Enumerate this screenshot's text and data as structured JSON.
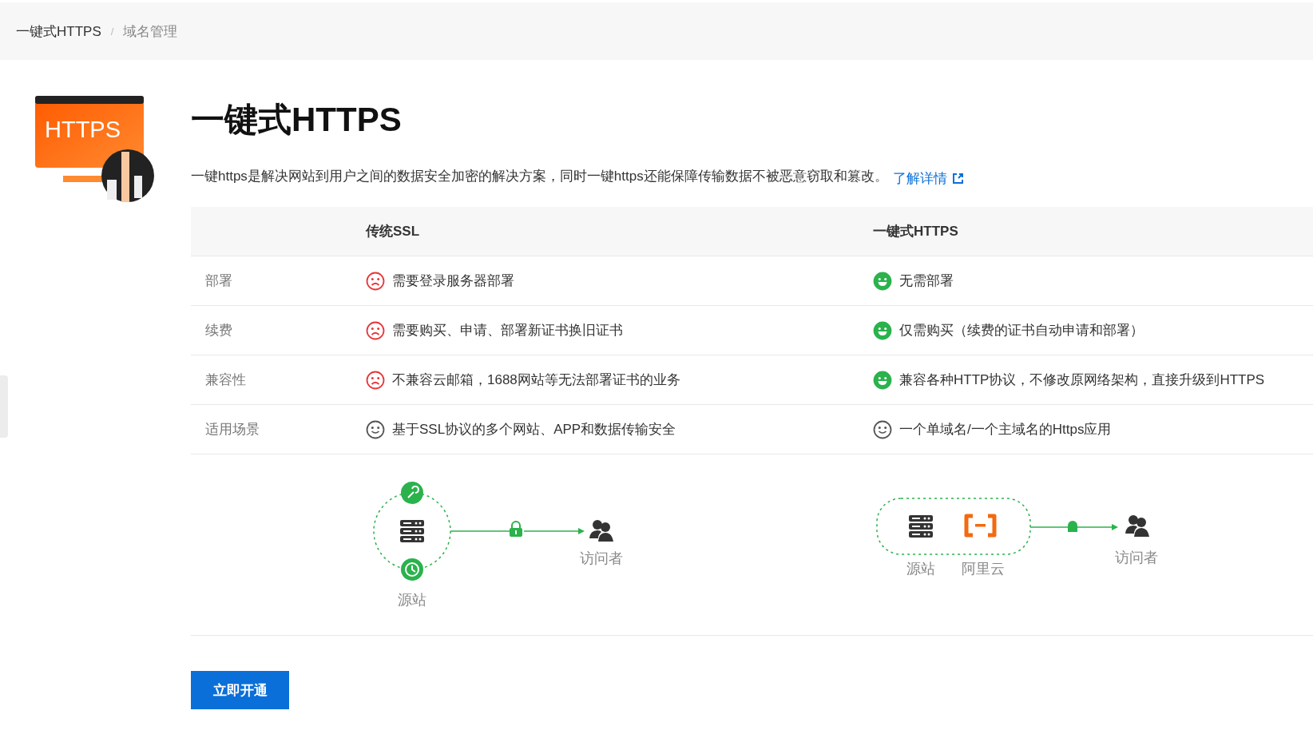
{
  "breadcrumb": [
    {
      "label": "一键式HTTPS",
      "current": false
    },
    {
      "label": "域名管理",
      "current": true
    }
  ],
  "breadcrumb_separator": "/",
  "logo": {
    "text": "HTTPS"
  },
  "title": "一键式HTTPS",
  "description": "一键https是解决网站到用户之间的数据安全加密的解决方案，同时一键https还能保障传输数据不被恶意窃取和篡改。",
  "learn_more": "了解详情",
  "table": {
    "columns": [
      "传统SSL",
      "一键式HTTPS"
    ],
    "rows": [
      {
        "label": "部署",
        "cells": [
          {
            "kind": "sad",
            "text": "需要登录服务器部署"
          },
          {
            "kind": "happy",
            "text": "无需部署"
          }
        ]
      },
      {
        "label": "续费",
        "cells": [
          {
            "kind": "sad",
            "text": "需要购买、申请、部署新证书换旧证书"
          },
          {
            "kind": "happy",
            "text": "仅需购买（续费的证书自动申请和部署）"
          }
        ]
      },
      {
        "label": "兼容性",
        "cells": [
          {
            "kind": "sad",
            "text": "不兼容云邮箱，1688网站等无法部署证书的业务"
          },
          {
            "kind": "happy",
            "text": "兼容各种HTTP协议，不修改原网络架构，直接升级到HTTPS"
          }
        ]
      },
      {
        "label": "适用场景",
        "cells": [
          {
            "kind": "neutral",
            "text": "基于SSL协议的多个网站、APP和数据传输安全"
          },
          {
            "kind": "neutral",
            "text": "一个单域名/一个主域名的Https应用"
          }
        ]
      }
    ]
  },
  "diagrams": [
    {
      "kind": "origin",
      "labels": [
        "源站",
        "访问者"
      ]
    },
    {
      "kind": "cloud",
      "labels": [
        "源站",
        "阿里云",
        "访问者"
      ]
    }
  ],
  "primary_button": "立即开通"
}
